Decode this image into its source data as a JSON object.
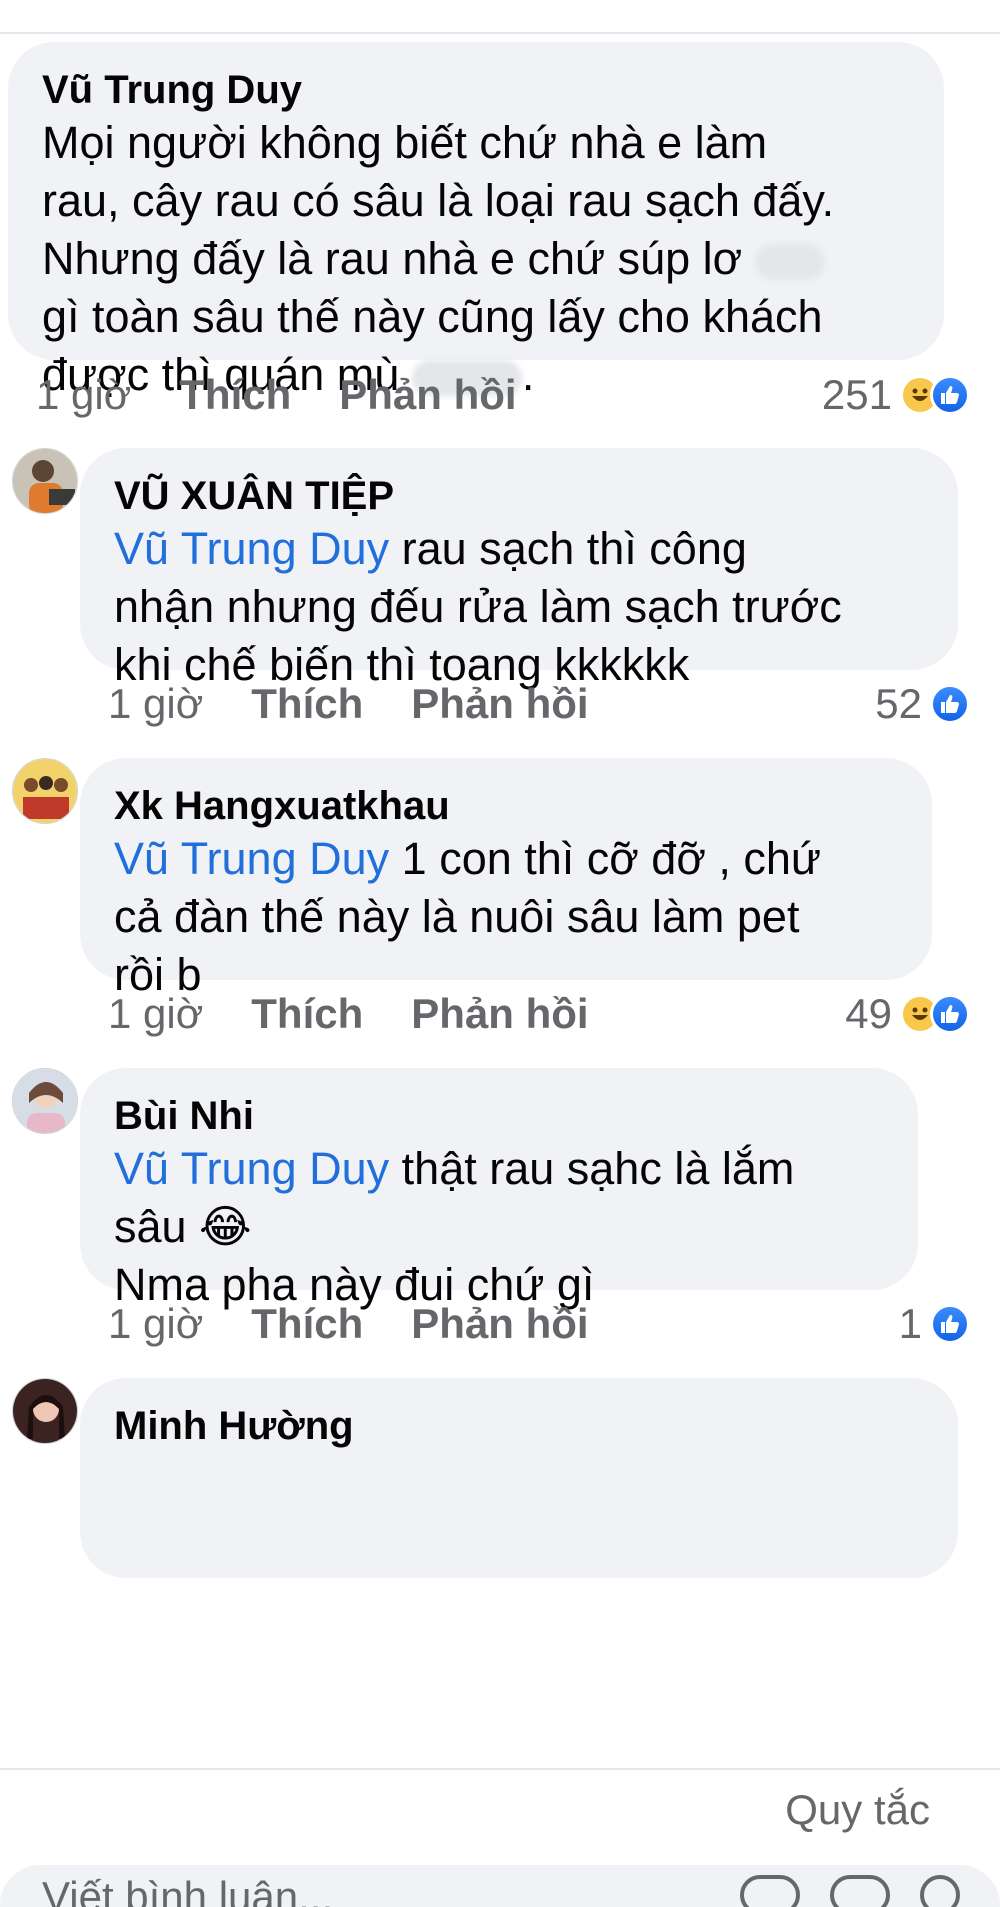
{
  "comments": [
    {
      "author": "Vũ Trung Duy",
      "text_lines": [
        "Mọi người không biết chứ nhà e làm",
        "rau, cây rau có sâu là loại rau sạch đấy.",
        "Nhưng đấy là rau nhà e chứ súp lơ",
        "gì toàn sâu thế này cũng lấy cho khách",
        "được thì quán mù"
      ],
      "time": "1 giờ",
      "like_label": "Thích",
      "reply_label": "Phản hồi",
      "reaction_count": "251"
    },
    {
      "author": "VŨ XUÂN TIỆP",
      "mention": "Vũ Trung Duy",
      "text_lines": [
        " rau sạch thì công",
        "nhận nhưng đếu rửa làm sạch trước",
        "khi chế biến thì toang kkkkkk"
      ],
      "time": "1 giờ",
      "like_label": "Thích",
      "reply_label": "Phản hồi",
      "reaction_count": "52"
    },
    {
      "author": "Xk Hangxuatkhau",
      "mention": "Vũ Trung Duy",
      "text_lines": [
        " 1 con thì cỡ đỡ , chứ",
        "cả đàn thế này là nuôi sâu làm pet",
        "rồi b"
      ],
      "time": "1 giờ",
      "like_label": "Thích",
      "reply_label": "Phản hồi",
      "reaction_count": "49"
    },
    {
      "author": "Bùi Nhi",
      "mention": "Vũ Trung Duy",
      "text_lines": [
        " thật rau sạhc là lắm",
        "sâu 😂",
        "Nma pha này đui chứ gì"
      ],
      "time": "1 giờ",
      "like_label": "Thích",
      "reply_label": "Phản hồi",
      "reaction_count": "1"
    },
    {
      "author": "Minh Hường"
    }
  ],
  "footer": {
    "rules_label": "Quy tắc",
    "input_placeholder": "Viết bình luận..."
  },
  "colors": {
    "mention": "#216fdb",
    "bubble": "#f0f2f5",
    "like_blue": "#1877f2",
    "haha_yellow": "#f7c84b"
  },
  "icons": [
    "like-icon",
    "haha-icon",
    "camera-icon",
    "gif-icon",
    "sticker-icon"
  ]
}
